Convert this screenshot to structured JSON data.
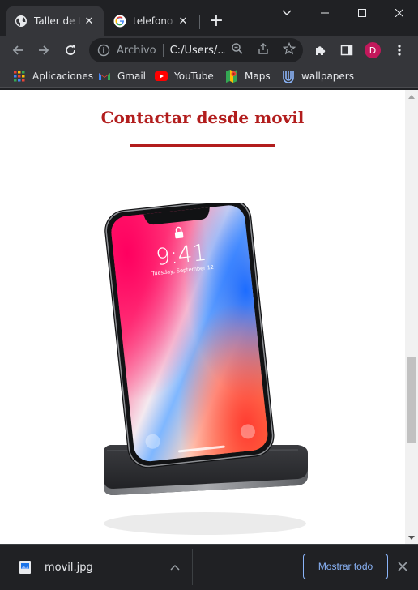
{
  "browser": {
    "tabs": [
      {
        "title": "Taller de tiro",
        "favicon": "globe-icon",
        "active": true
      },
      {
        "title": "telefono movil",
        "favicon": "google-icon",
        "active": false
      }
    ],
    "new_tab_symbol": "+",
    "tab_close_symbol": "✕",
    "address": {
      "scheme_label": "Archivo",
      "url": "C:/Users/..."
    },
    "profile_initial": "D",
    "bookmarks": [
      {
        "label": "Aplicaciones",
        "icon": "apps-grid-icon"
      },
      {
        "label": "Gmail",
        "icon": "gmail-icon"
      },
      {
        "label": "YouTube",
        "icon": "youtube-icon"
      },
      {
        "label": "Maps",
        "icon": "maps-icon"
      },
      {
        "label": "wallpapers",
        "icon": "wallpapers-icon"
      }
    ]
  },
  "page": {
    "heading": "Contactar desde movil",
    "phone_screen": {
      "time": "9:41",
      "date": "Tuesday, September 12"
    }
  },
  "downloads": {
    "file_name": "movil.jpg",
    "show_all_label": "Mostrar todo"
  },
  "colors": {
    "heading_red": "#b21d1d",
    "chrome_dark": "#202124",
    "toolbar": "#35363a",
    "link_blue": "#8ab4f8",
    "avatar_bg": "#c2185b"
  }
}
